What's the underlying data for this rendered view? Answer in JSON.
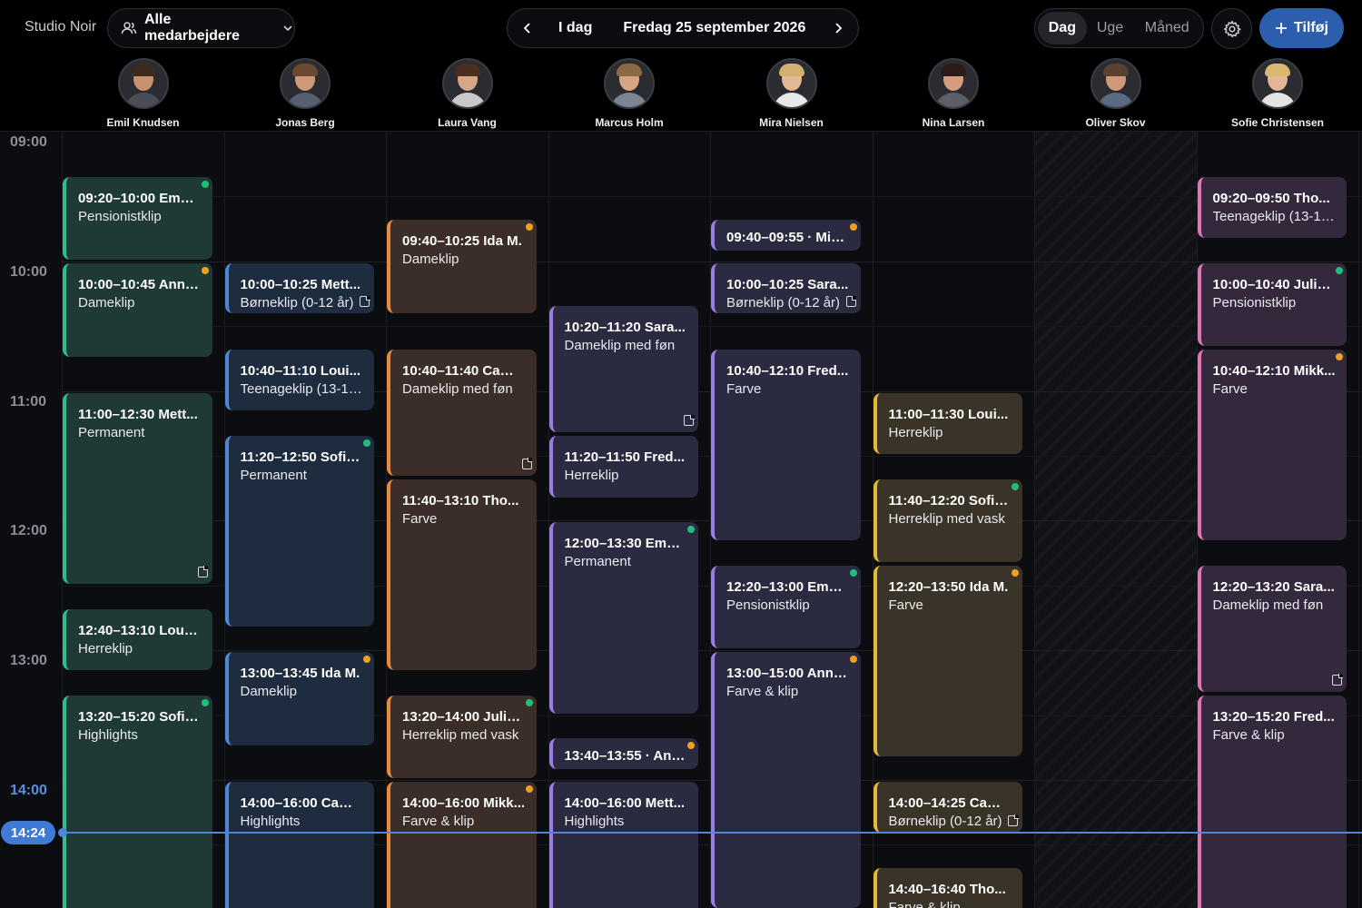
{
  "app": {
    "brand": "Studio Noir"
  },
  "toolbar": {
    "staff_filter": "Alle medarbejdere",
    "today": "I dag",
    "date": "Fredag 25 september 2026",
    "views": [
      {
        "label": "Dag",
        "active": true
      },
      {
        "label": "Uge",
        "active": false
      },
      {
        "label": "Måned",
        "active": false
      }
    ],
    "add_label": "Tilføj",
    "icons": {
      "people": "people-icon",
      "chevron": "chevron-down-icon",
      "prev": "chevron-left-icon",
      "next": "chevron-right-icon",
      "settings": "gear-icon",
      "add": "plus-icon"
    }
  },
  "colors": {
    "green": "#2fbf8f",
    "blue": "#4f86d4",
    "orange": "#e88a3c",
    "purple": "#9a7ee3",
    "yellow": "#e2b93a",
    "pink": "#e076b4",
    "dot_green": "#1fbf7a",
    "dot_orange": "#f0a020",
    "now": "#4d86db"
  },
  "staff": [
    {
      "name": "Emil Knudsen",
      "color": "green",
      "skin": "#c9926e",
      "hair": "#3a2a20",
      "shirt": "#4a4d55"
    },
    {
      "name": "Jonas Berg",
      "color": "blue",
      "skin": "#d09a78",
      "hair": "#6b4a30",
      "shirt": "#556070"
    },
    {
      "name": "Laura Vang",
      "color": "orange",
      "skin": "#d8a585",
      "hair": "#4a2e1e",
      "shirt": "#c9c9c9"
    },
    {
      "name": "Marcus Holm",
      "color": "purple",
      "skin": "#d7a382",
      "hair": "#8a6a45",
      "shirt": "#7d8593"
    },
    {
      "name": "Mira Nielsen",
      "color": "purple",
      "skin": "#e4b796",
      "hair": "#d2b070",
      "shirt": "#e8e8e8"
    },
    {
      "name": "Nina Larsen",
      "color": "yellow",
      "skin": "#d49c7c",
      "hair": "#2a1c16",
      "shirt": "#5c5f66"
    },
    {
      "name": "Oliver Skov",
      "color": "none",
      "skin": "#cf9a7a",
      "hair": "#5a4030",
      "shirt": "#5a6a80"
    },
    {
      "name": "Sofie Christensen",
      "color": "pink",
      "skin": "#e2b696",
      "hair": "#d8b86e",
      "shirt": "#e4e4e4"
    }
  ],
  "times": [
    "09:00",
    "10:00",
    "11:00",
    "12:00",
    "13:00",
    "14:00"
  ],
  "now": {
    "label": "14:24",
    "minutes": 864
  },
  "day_start_minutes": 540,
  "unavailable_columns": [
    6
  ],
  "events": [
    {
      "col": 0,
      "start": "09:20",
      "end": "10:00",
      "time": "09:20–10:00",
      "name": "Emm...",
      "service": "Pensionistklip",
      "dot": "green"
    },
    {
      "col": 0,
      "start": "10:00",
      "end": "10:45",
      "time": "10:00–10:45",
      "name": "Anna...",
      "service": "Dameklip",
      "dot": "orange"
    },
    {
      "col": 0,
      "start": "11:00",
      "end": "12:30",
      "time": "11:00–12:30",
      "name": "Mett...",
      "service": "Permanent",
      "note": true
    },
    {
      "col": 0,
      "start": "12:40",
      "end": "13:10",
      "time": "12:40–13:10",
      "name": "Louis...",
      "service": "Herreklip"
    },
    {
      "col": 0,
      "start": "13:20",
      "end": "15:20",
      "time": "13:20–15:20",
      "name": "Sofia...",
      "service": "Highlights",
      "dot": "green"
    },
    {
      "col": 1,
      "start": "10:00",
      "end": "10:25",
      "time": "10:00–10:25",
      "name": "Mett...",
      "service": "Børneklip (0-12 år)",
      "note": true
    },
    {
      "col": 1,
      "start": "10:40",
      "end": "11:10",
      "time": "10:40–11:10",
      "name": "Loui...",
      "service": "Teenageklip (13-17 ..."
    },
    {
      "col": 1,
      "start": "11:20",
      "end": "12:50",
      "time": "11:20–12:50",
      "name": "Sofia...",
      "service": "Permanent",
      "dot": "green"
    },
    {
      "col": 1,
      "start": "13:00",
      "end": "13:45",
      "time": "13:00–13:45",
      "name": "Ida M.",
      "service": "Dameklip",
      "dot": "orange"
    },
    {
      "col": 1,
      "start": "14:00",
      "end": "16:00",
      "time": "14:00–16:00",
      "name": "Cami...",
      "service": "Highlights"
    },
    {
      "col": 2,
      "start": "09:40",
      "end": "10:25",
      "time": "09:40–10:25",
      "name": "Ida M.",
      "service": "Dameklip",
      "dot": "orange"
    },
    {
      "col": 2,
      "start": "10:40",
      "end": "11:40",
      "time": "10:40–11:40",
      "name": "Cami...",
      "service": "Dameklip med føn",
      "note": true
    },
    {
      "col": 2,
      "start": "11:40",
      "end": "13:10",
      "time": "11:40–13:10",
      "name": "Tho...",
      "service": "Farve"
    },
    {
      "col": 2,
      "start": "13:20",
      "end": "14:00",
      "time": "13:20–14:00",
      "name": "Julie...",
      "service": "Herreklip med vask",
      "dot": "green"
    },
    {
      "col": 2,
      "start": "14:00",
      "end": "16:00",
      "time": "14:00–16:00",
      "name": "Mikk...",
      "service": "Farve & klip",
      "dot": "orange"
    },
    {
      "col": 3,
      "start": "10:20",
      "end": "11:20",
      "time": "10:20–11:20",
      "name": "Sara...",
      "service": "Dameklip med føn",
      "note": true
    },
    {
      "col": 3,
      "start": "11:20",
      "end": "11:50",
      "time": "11:20–11:50",
      "name": "Fred...",
      "service": "Herreklip"
    },
    {
      "col": 3,
      "start": "12:00",
      "end": "13:30",
      "time": "12:00–13:30",
      "name": "Emm...",
      "service": "Permanent",
      "dot": "green"
    },
    {
      "col": 3,
      "start": "13:40",
      "end": "13:55",
      "time": "13:40–13:55",
      "name": "· Ann...",
      "service": "",
      "dot": "orange",
      "single": true
    },
    {
      "col": 3,
      "start": "14:00",
      "end": "16:00",
      "time": "14:00–16:00",
      "name": "Mett...",
      "service": "Highlights"
    },
    {
      "col": 4,
      "start": "09:40",
      "end": "09:55",
      "time": "09:40–09:55",
      "name": "· Mikk...",
      "service": "",
      "dot": "orange",
      "single": true
    },
    {
      "col": 4,
      "start": "10:00",
      "end": "10:25",
      "time": "10:00–10:25",
      "name": "Sara...",
      "service": "Børneklip (0-12 år)",
      "note": true
    },
    {
      "col": 4,
      "start": "10:40",
      "end": "12:10",
      "time": "10:40–12:10",
      "name": "Fred...",
      "service": "Farve"
    },
    {
      "col": 4,
      "start": "12:20",
      "end": "13:00",
      "time": "12:20–13:00",
      "name": "Emm...",
      "service": "Pensionistklip",
      "dot": "green"
    },
    {
      "col": 4,
      "start": "13:00",
      "end": "15:00",
      "time": "13:00–15:00",
      "name": "Anna...",
      "service": "Farve & klip",
      "dot": "orange"
    },
    {
      "col": 5,
      "start": "11:00",
      "end": "11:30",
      "time": "11:00–11:30",
      "name": "Loui...",
      "service": "Herreklip"
    },
    {
      "col": 5,
      "start": "11:40",
      "end": "12:20",
      "time": "11:40–12:20",
      "name": "Sofia...",
      "service": "Herreklip med vask",
      "dot": "green"
    },
    {
      "col": 5,
      "start": "12:20",
      "end": "13:50",
      "time": "12:20–13:50",
      "name": "Ida M.",
      "service": "Farve",
      "dot": "orange"
    },
    {
      "col": 5,
      "start": "14:00",
      "end": "14:25",
      "time": "14:00–14:25",
      "name": "Cami...",
      "service": "Børneklip (0-12 år)",
      "note": true
    },
    {
      "col": 5,
      "start": "14:40",
      "end": "16:40",
      "time": "14:40–16:40",
      "name": "Tho...",
      "service": "Farve & klip"
    },
    {
      "col": 7,
      "start": "09:20",
      "end": "09:50",
      "time": "09:20–09:50",
      "name": "Tho...",
      "service": "Teenageklip (13-17 ..."
    },
    {
      "col": 7,
      "start": "10:00",
      "end": "10:40",
      "time": "10:00–10:40",
      "name": "Julie...",
      "service": "Pensionistklip",
      "dot": "green"
    },
    {
      "col": 7,
      "start": "10:40",
      "end": "12:10",
      "time": "10:40–12:10",
      "name": "Mikk...",
      "service": "Farve",
      "dot": "orange"
    },
    {
      "col": 7,
      "start": "12:20",
      "end": "13:20",
      "time": "12:20–13:20",
      "name": "Sara...",
      "service": "Dameklip med føn",
      "note": true
    },
    {
      "col": 7,
      "start": "13:20",
      "end": "15:20",
      "time": "13:20–15:20",
      "name": "Fred...",
      "service": "Farve & klip"
    }
  ]
}
